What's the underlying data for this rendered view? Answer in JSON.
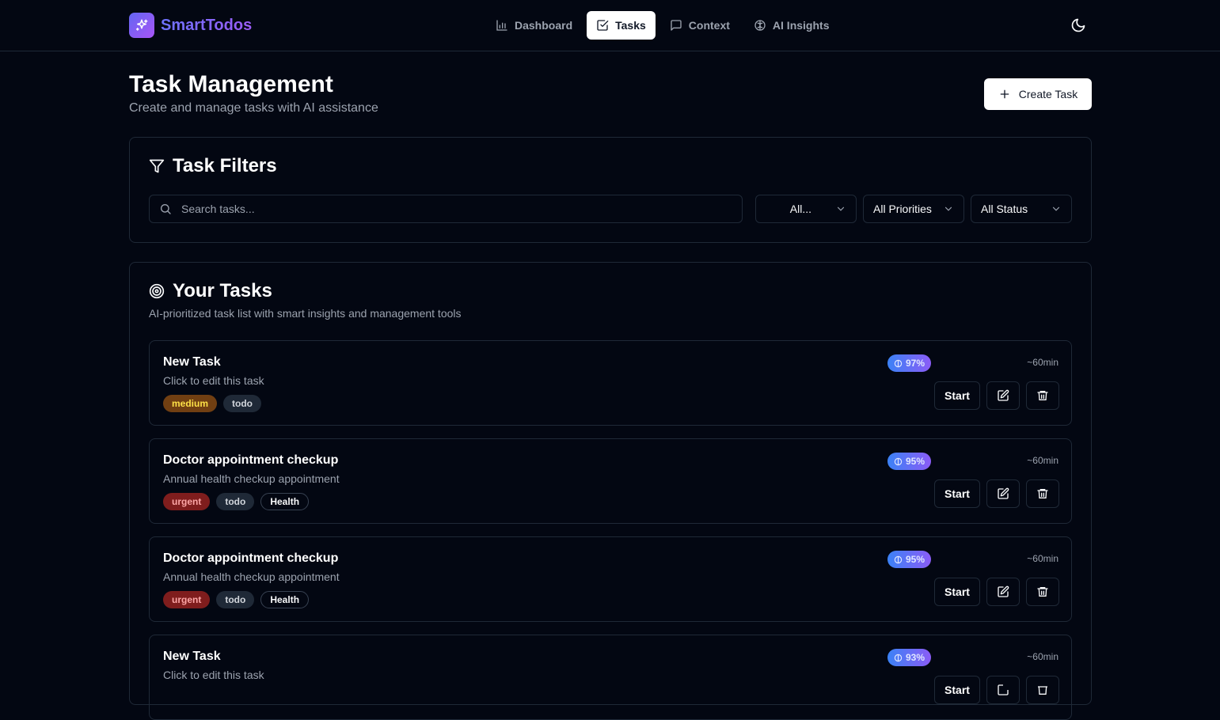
{
  "app": {
    "name": "SmartTodos",
    "logo_icon": "sparkles-icon"
  },
  "nav": {
    "items": [
      {
        "label": "Dashboard",
        "icon": "bar-chart-icon",
        "active": false
      },
      {
        "label": "Tasks",
        "icon": "check-square-icon",
        "active": true
      },
      {
        "label": "Context",
        "icon": "message-square-icon",
        "active": false
      },
      {
        "label": "AI Insights",
        "icon": "brain-icon",
        "active": false
      }
    ],
    "theme_toggle_icon": "moon-icon"
  },
  "header": {
    "title": "Task Management",
    "subtitle": "Create and manage tasks with AI assistance",
    "create_button": "Create Task"
  },
  "filters": {
    "title": "Task Filters",
    "search_placeholder": "Search tasks...",
    "category": "All...",
    "priority": "All Priorities",
    "status": "All Status"
  },
  "tasks_section": {
    "title": "Your Tasks",
    "description": "AI-prioritized task list with smart insights and management tools",
    "start_label": "Start"
  },
  "tasks": [
    {
      "title": "New Task",
      "description": "Click to edit this task",
      "priority": "medium",
      "status": "todo",
      "category": "",
      "score": "97%",
      "duration": "~60min"
    },
    {
      "title": "Doctor appointment checkup",
      "description": "Annual health checkup appointment",
      "priority": "urgent",
      "status": "todo",
      "category": "Health",
      "score": "95%",
      "duration": "~60min"
    },
    {
      "title": "Doctor appointment checkup",
      "description": "Annual health checkup appointment",
      "priority": "urgent",
      "status": "todo",
      "category": "Health",
      "score": "95%",
      "duration": "~60min"
    },
    {
      "title": "New Task",
      "description": "Click to edit this task",
      "priority": "",
      "status": "",
      "category": "",
      "score": "93%",
      "duration": "~60min"
    }
  ],
  "colors": {
    "background": "#030712",
    "border": "#1f2937",
    "brand_gradient_start": "#6366f1",
    "brand_gradient_end": "#a855f7",
    "medium_tag": "#713f12",
    "urgent_tag": "#7f1d1d"
  }
}
